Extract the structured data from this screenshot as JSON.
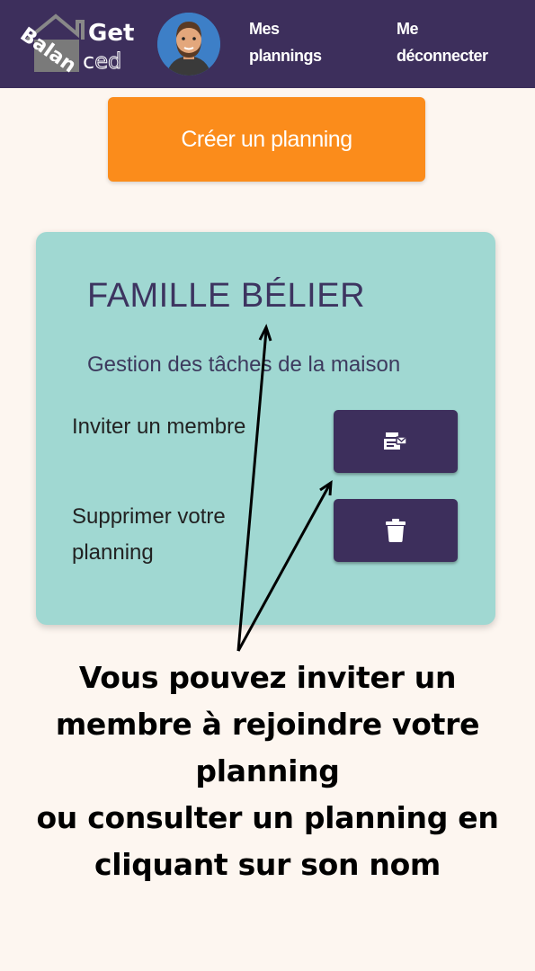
{
  "header": {
    "logo": {
      "line1": "Get",
      "rotated": "Balan",
      "line2_a": "c",
      "line2_b": "ed"
    },
    "nav": {
      "my_plannings": "Mes plannings",
      "logout": "Me déconnecter"
    },
    "colors": {
      "background": "#3d2f5c"
    }
  },
  "main": {
    "create_button": "Créer un planning",
    "card": {
      "title": "FAMILLE BÉLIER",
      "description": "Gestion des tâches de la maison",
      "invite_label": "Inviter un membre",
      "invite_icon": "invite-user-icon",
      "delete_label": "Supprimer votre planning",
      "delete_icon": "trash-icon"
    }
  },
  "annotation": {
    "lines": [
      "Vous pouvez inviter un",
      "membre à rejoindre votre",
      "planning",
      "ou consulter un planning en",
      "cliquant sur son nom"
    ]
  },
  "colors": {
    "page_bg": "#fdf6f0",
    "accent_orange": "#fb8c1b",
    "card_bg": "#a0d8d2",
    "dark_purple": "#3d2f5c"
  }
}
